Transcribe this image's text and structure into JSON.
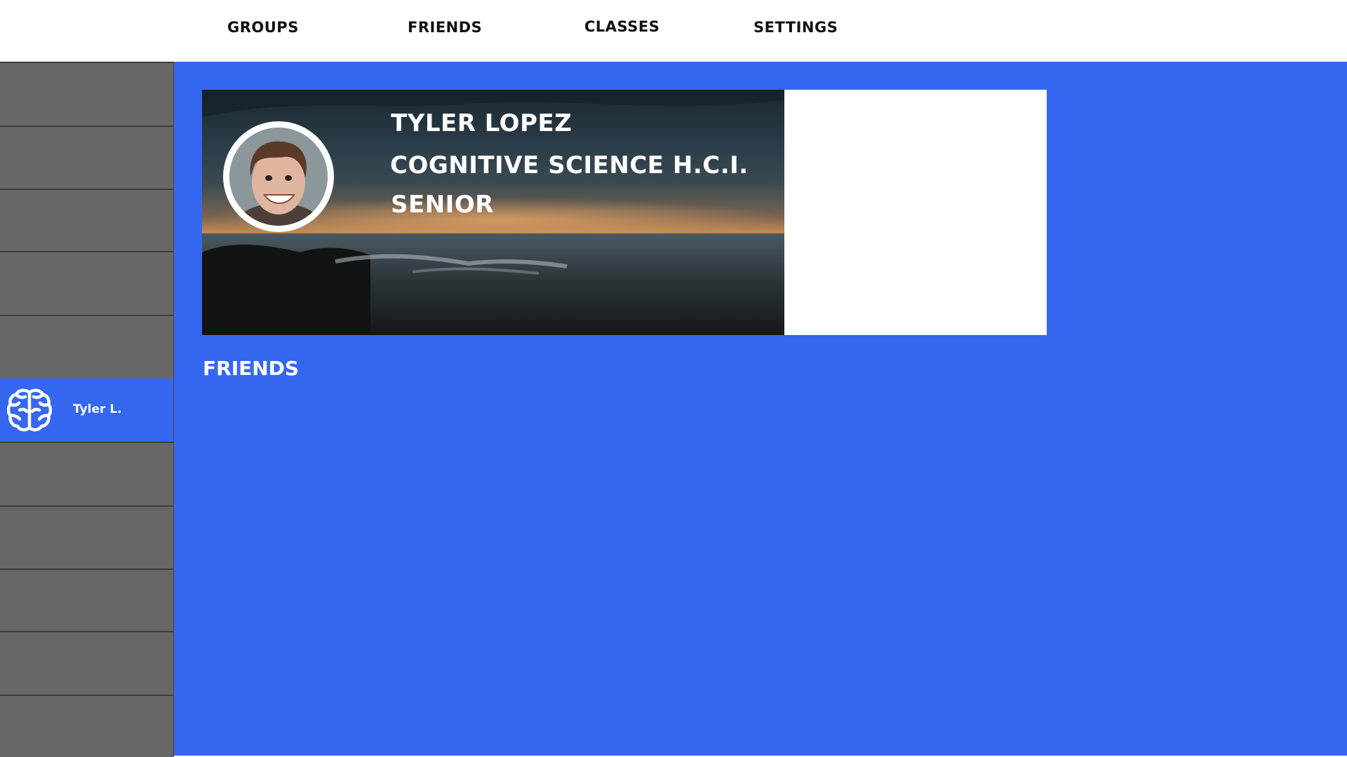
{
  "nav": {
    "items": [
      {
        "label": "GROUPS"
      },
      {
        "label": "FRIENDS"
      },
      {
        "label": "CLASSES"
      },
      {
        "label": "SETTINGS"
      }
    ]
  },
  "sidebar": {
    "active_item": {
      "label": "Tyler L.",
      "icon": "brain-icon"
    }
  },
  "profile": {
    "name": "TYLER LOPEZ",
    "major": "COGNITIVE SCIENCE H.C.I.",
    "year": "SENIOR"
  },
  "section": {
    "friends_heading": "FRIENDS"
  },
  "colors": {
    "accent": "#3567f0",
    "sidebar": "#676767",
    "nav_background": "#ffffff"
  }
}
